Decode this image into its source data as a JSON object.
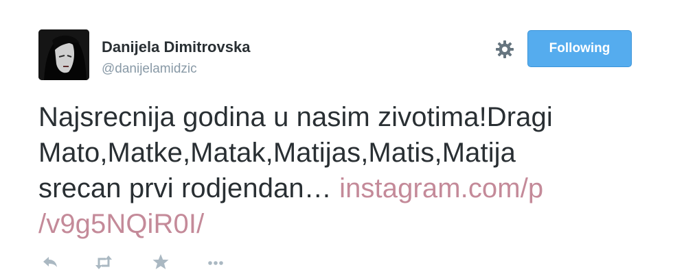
{
  "user": {
    "full_name": "Danijela Dimitrovska",
    "screen_name": "@danijelamidzic"
  },
  "follow_button": {
    "label": "Following"
  },
  "tweet": {
    "text_line1": "Najsrecnija godina u nasim zivotima!Dragi",
    "text_line2": "Mato,Matke,Matak,Matijas,Matis,Matija",
    "text_line3": "srecan prvi rodjendan…",
    "link_part1": "instagram.com/p",
    "link_part2": "/v9g5NQiR0I/"
  },
  "actions": [
    {
      "icon": "reply-icon"
    },
    {
      "icon": "retweet-icon"
    },
    {
      "icon": "favorite-star-icon"
    },
    {
      "icon": "more-icon"
    }
  ],
  "colors": {
    "follow_button_bg": "#55acee",
    "link": "#c48a99",
    "secondary_text": "#8899a6",
    "action_icon": "#aab8c2"
  }
}
